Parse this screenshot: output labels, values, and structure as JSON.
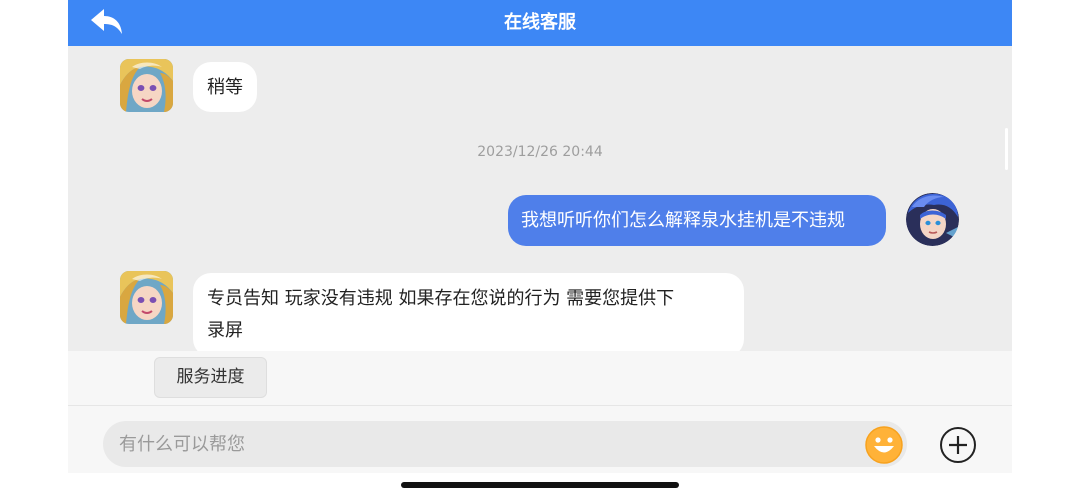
{
  "header": {
    "title": "在线客服",
    "back_icon": "back-arrow-icon",
    "accent_color": "#3d87f5"
  },
  "messages": [
    {
      "side": "left",
      "sender": "agent",
      "avatar_icon": "agent-avatar",
      "text": "稍等"
    },
    {
      "type": "timestamp",
      "text": "2023/12/26 20:44"
    },
    {
      "side": "right",
      "sender": "user",
      "avatar_icon": "user-avatar",
      "text": "我想听听你们怎么解释泉水挂机是不违规",
      "bubble_color": "#4f7fea"
    },
    {
      "side": "left",
      "sender": "agent",
      "avatar_icon": "agent-avatar",
      "text_lines": [
        "专员告知 玩家没有违规 如果存在您说的行为 需要您提供下",
        "录屏"
      ]
    }
  ],
  "quick_actions": [
    {
      "label": "服务进度"
    }
  ],
  "composer": {
    "placeholder": "有什么可以帮您",
    "emoji_icon": "emoji-icon",
    "plus_icon": "plus-circle-icon"
  }
}
